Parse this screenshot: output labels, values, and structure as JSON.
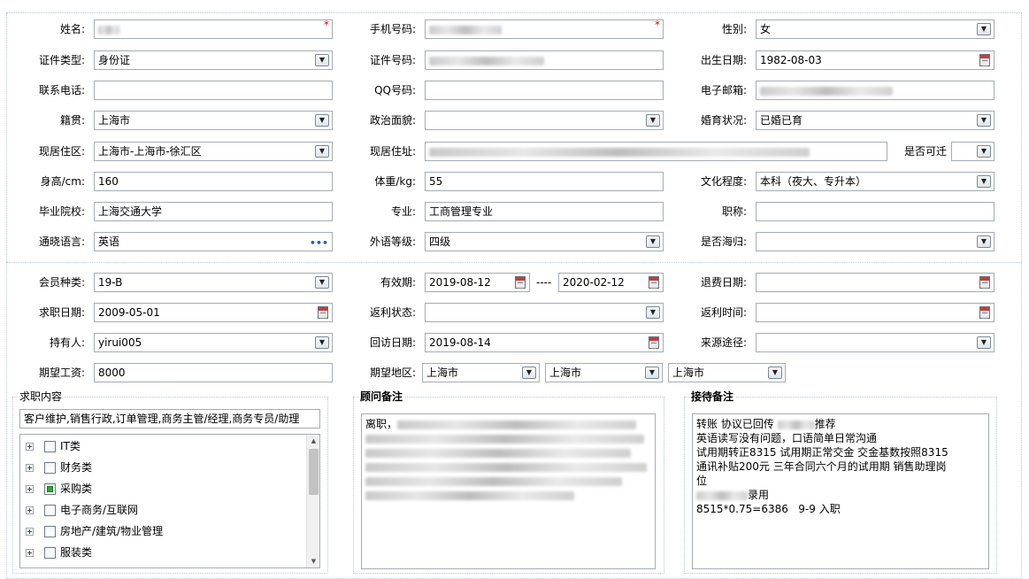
{
  "form": {
    "name_label": "姓名:",
    "mobile_label": "手机号码:",
    "gender_label": "性别:",
    "gender_value": "女",
    "id_type_label": "证件类型:",
    "id_type_value": "身份证",
    "id_number_label": "证件号码:",
    "birth_label": "出生日期:",
    "birth_value": "1982-08-03",
    "phone_label": "联系电话:",
    "qq_label": "QQ号码:",
    "email_label": "电子邮箱:",
    "native_label": "籍贯:",
    "native_value": "上海市",
    "political_label": "政治面貌:",
    "marital_label": "婚育状况:",
    "marital_value": "已婚已育",
    "district_label": "现居住区:",
    "district_value": "上海市-上海市-徐汇区",
    "address_label": "现居住址:",
    "relocate_label": "是否可迁",
    "height_label": "身高/cm:",
    "height_value": "160",
    "weight_label": "体重/kg:",
    "weight_value": "55",
    "education_label": "文化程度:",
    "education_value": "本科（夜大、专升本）",
    "school_label": "毕业院校:",
    "school_value": "上海交通大学",
    "major_label": "专业:",
    "major_value": "工商管理专业",
    "title_label": "职称:",
    "language_label": "通晓语言:",
    "language_value": "英语",
    "foreign_level_label": "外语等级:",
    "foreign_level_value": "四级",
    "overseas_label": "是否海归:",
    "required_mark": "*",
    "ellipsis": "•••"
  },
  "membership": {
    "type_label": "会员种类:",
    "type_value": "19-B",
    "valid_label": "有效期:",
    "valid_from": "2019-08-12",
    "valid_sep": "----",
    "valid_to": "2020-02-12",
    "refund_date_label": "退费日期:",
    "job_date_label": "求职日期:",
    "job_date_value": "2009-05-01",
    "rebate_status_label": "返利状态:",
    "rebate_time_label": "返利时间:",
    "holder_label": "持有人:",
    "holder_value": "yirui005",
    "revisit_label": "回访日期:",
    "revisit_value": "2019-08-14",
    "source_label": "来源途径:",
    "salary_label": "期望工资:",
    "salary_value": "8000",
    "region_label": "期望地区:",
    "region_1": "上海市",
    "region_2": "上海市",
    "region_3": "上海市"
  },
  "job": {
    "title": "求职内容",
    "summary": "客户维护,销售行政,订单管理,商务主管/经理,商务专员/助理",
    "tree": [
      {
        "label": "IT类",
        "checked": false
      },
      {
        "label": "财务类",
        "checked": false
      },
      {
        "label": "采购类",
        "checked": true
      },
      {
        "label": "电子商务/互联网",
        "checked": false
      },
      {
        "label": "房地产/建筑/物业管理",
        "checked": false
      },
      {
        "label": "服装类",
        "checked": false
      }
    ]
  },
  "advisor": {
    "title": "顾问备注",
    "first_line": "离职，"
  },
  "reception": {
    "title": "接待备注",
    "line1a": "转账 协议已回传",
    "line1b": "推荐",
    "line2": "英语读写没有问题，口语简单日常沟通",
    "line3": "试用期转正8315 试用期正常交金 交金基数按照8315",
    "line4": "通讯补贴200元 三年合同六个月的试用期 销售助理岗",
    "line5": "位",
    "line6": "录用",
    "line7": "8515*0.75=6386   9-9 入职"
  }
}
